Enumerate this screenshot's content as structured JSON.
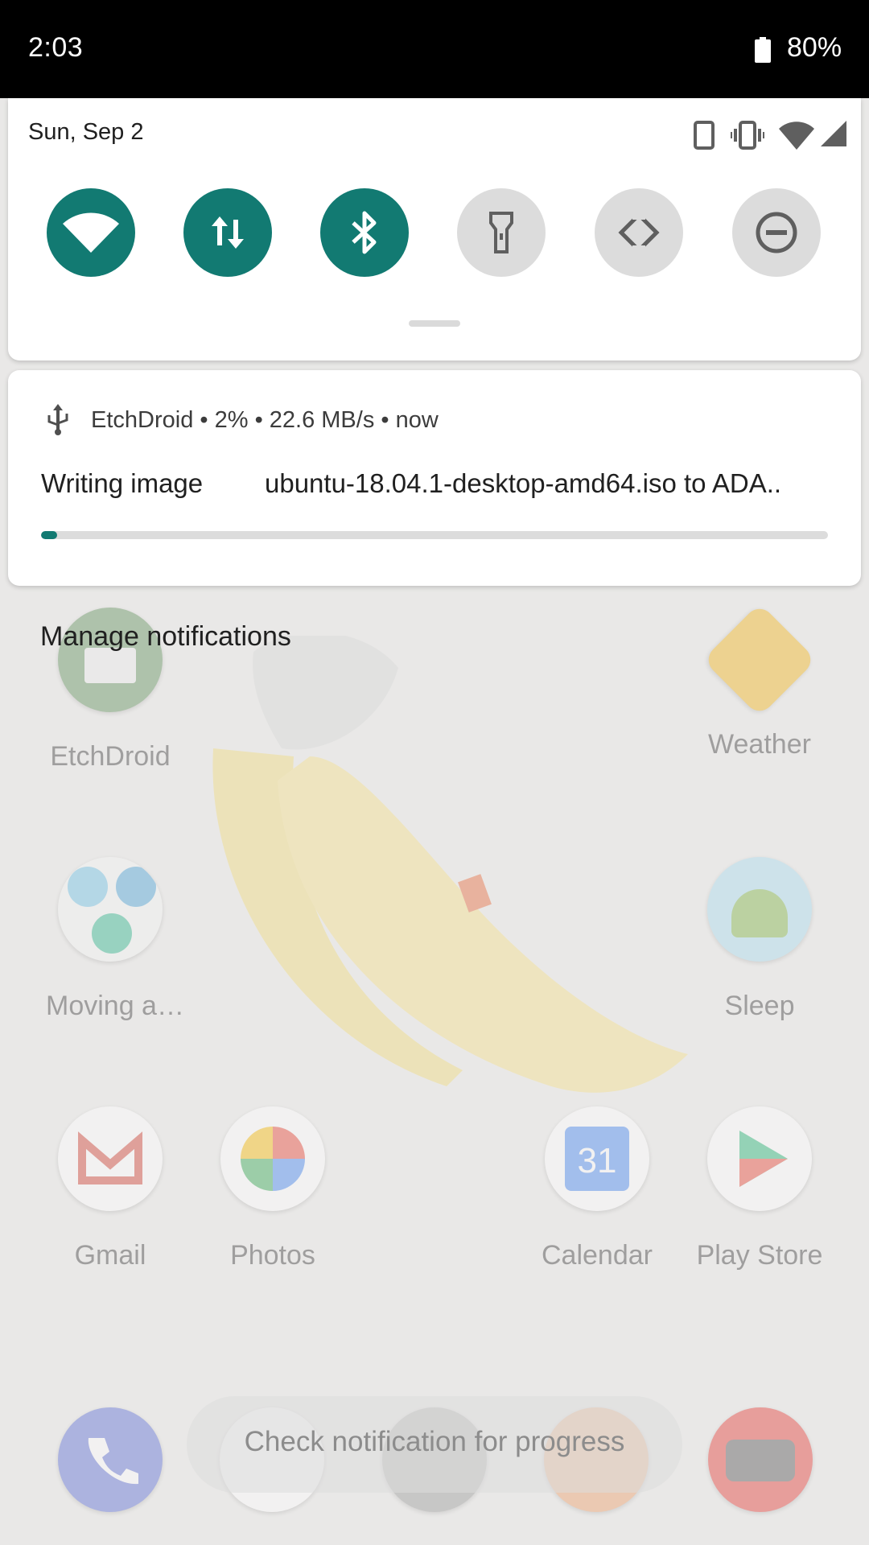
{
  "status_bar": {
    "time": "2:03",
    "battery": "80%"
  },
  "quick_settings": {
    "date": "Sun, Sep 2",
    "tiles": [
      {
        "name": "wifi",
        "state": "on"
      },
      {
        "name": "mobile-data",
        "state": "on"
      },
      {
        "name": "bluetooth",
        "state": "on"
      },
      {
        "name": "flashlight",
        "state": "off"
      },
      {
        "name": "auto-rotate",
        "state": "off"
      },
      {
        "name": "do-not-disturb",
        "state": "off"
      }
    ],
    "status_icons": [
      "phone-icon",
      "vibrate-icon",
      "wifi-signal-icon",
      "cell-signal-icon"
    ]
  },
  "notification": {
    "header": "EtchDroid • 2% • 22.6 MB/s • now",
    "title": "Writing image",
    "text": "ubuntu-18.04.1-desktop-amd64.iso to ADA..",
    "progress": 0.02
  },
  "manage_notifications": "Manage notifications",
  "home": {
    "apps": [
      {
        "label": "EtchDroid"
      },
      {
        "label": "Weather"
      },
      {
        "label": "Moving a…"
      },
      {
        "label": "Sleep"
      },
      {
        "label": "Gmail"
      },
      {
        "label": "Photos"
      },
      {
        "label": "Calendar"
      },
      {
        "label": "Play Store"
      }
    ],
    "calendar_day": "31",
    "toast": "Check notification for progress"
  },
  "colors": {
    "accent": "#127a72",
    "tile_off": "#dcdcdc"
  }
}
